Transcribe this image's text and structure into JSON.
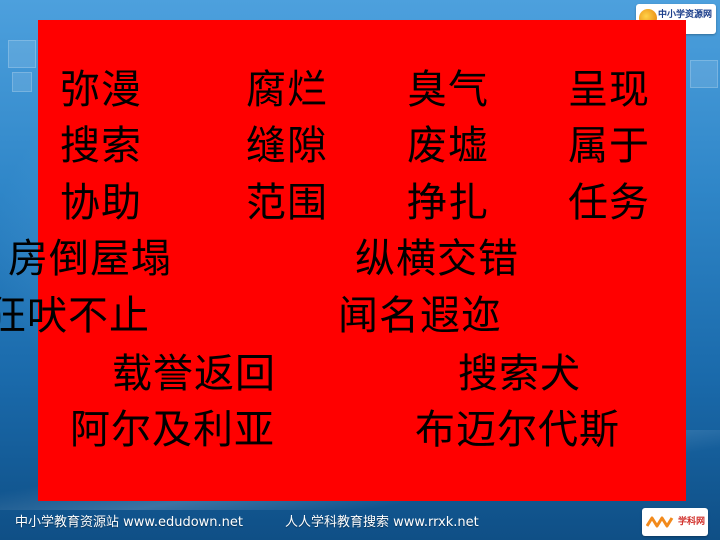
{
  "slide": {
    "rows": [
      [
        "弥漫",
        "腐烂",
        "臭气",
        "呈现"
      ],
      [
        "搜索",
        "缝隙",
        "废墟",
        "属于"
      ],
      [
        "协助",
        "范围",
        "挣扎",
        "任务"
      ]
    ],
    "phrases": [
      "房倒屋塌",
      "纵横交错",
      "狂吠不止",
      "闻名遐迩",
      "载誉返回",
      "搜索犬",
      "阿尔及利亚",
      "布迈尔代斯"
    ]
  },
  "logos": {
    "top_text": "中小学资源网",
    "bottom_text": "学科网"
  },
  "footer": {
    "left": "中小学教育资源站 www.edudown.net",
    "right": "人人学科教育搜索 www.rrxk.net"
  },
  "colors": {
    "panel": "#ff0000",
    "text": "#000000",
    "background": "#2f86c8"
  }
}
